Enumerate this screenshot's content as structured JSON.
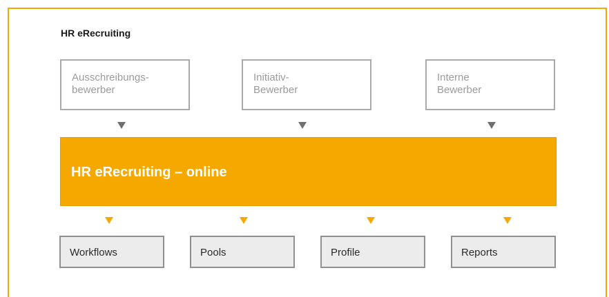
{
  "diagram": {
    "title": "HR eRecruiting",
    "sources": [
      {
        "lines": [
          "Ausschreibungs-",
          "bewerber"
        ]
      },
      {
        "lines": [
          "Initiativ-",
          "Bewerber"
        ]
      },
      {
        "lines": [
          "Interne",
          "Bewerber"
        ]
      }
    ],
    "main": {
      "label": "HR eRecruiting – online"
    },
    "modules": [
      {
        "label": "Workflows"
      },
      {
        "label": "Pools"
      },
      {
        "label": "Profile"
      },
      {
        "label": "Reports"
      }
    ],
    "colors": {
      "accent": "#f5a800",
      "source_border": "#a9a9a9",
      "source_text": "#9b9b9b",
      "module_fill": "#ececec",
      "module_border": "#8f8f8f",
      "arrow_grey": "#707070"
    }
  }
}
